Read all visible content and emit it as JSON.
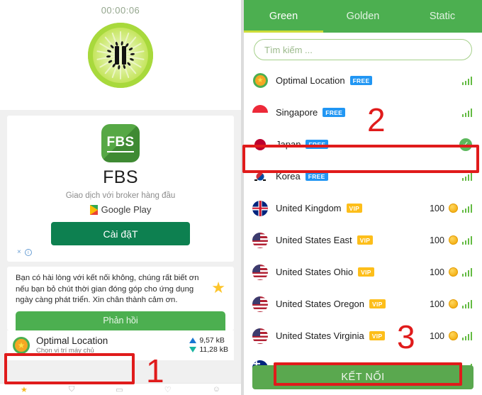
{
  "left": {
    "timer": "00:00:06",
    "pause_icon": "pause-icon",
    "ad": {
      "logo_text": "FBS",
      "title": "FBS",
      "subtitle": "Giao dịch với broker hàng đầu",
      "store_label": "Google Play",
      "install_label": "Cài đặT",
      "close_label": "×",
      "info_label": "i"
    },
    "feedback": {
      "text": "Bạn có hài lòng với kết nối không, chúng rất biết ơn nếu bạn bỏ chút thời gian đóng góp cho ứng dụng ngày càng phát triển. Xin chân thành cảm ơn.",
      "star_icon": "★",
      "button_label": "Phản hồi"
    },
    "optimal": {
      "title": "Optimal Location",
      "subtitle": "Chọn vị trí máy chủ",
      "upload": "9,57 kB",
      "download": "11,28 kB",
      "star_icon": "★"
    },
    "nav": [
      "★",
      "⛉",
      "▭",
      "♡",
      "☺"
    ]
  },
  "right": {
    "tabs": [
      {
        "label": "Green",
        "active": true
      },
      {
        "label": "Golden",
        "active": false
      },
      {
        "label": "Static",
        "active": false
      }
    ],
    "search": {
      "placeholder": "Tìm kiếm ...",
      "value": ""
    },
    "servers": [
      {
        "name": "Optimal Location",
        "badge": "FREE",
        "badge_type": "free",
        "flag": "star",
        "right": "signal",
        "cost": ""
      },
      {
        "name": "Singapore",
        "badge": "FREE",
        "badge_type": "free",
        "flag": "sg",
        "right": "signal",
        "cost": ""
      },
      {
        "name": "Japan",
        "badge": "FREE",
        "badge_type": "free",
        "flag": "jp",
        "right": "check",
        "cost": ""
      },
      {
        "name": "Korea",
        "badge": "FREE",
        "badge_type": "free",
        "flag": "kr",
        "right": "signal",
        "cost": ""
      },
      {
        "name": "United Kingdom",
        "badge": "VIP",
        "badge_type": "vip",
        "flag": "uk",
        "right": "signal",
        "cost": "100"
      },
      {
        "name": "United States East",
        "badge": "VIP",
        "badge_type": "vip",
        "flag": "us",
        "right": "signal",
        "cost": "100"
      },
      {
        "name": "United States Ohio",
        "badge": "VIP",
        "badge_type": "vip",
        "flag": "us",
        "right": "signal",
        "cost": "100"
      },
      {
        "name": "United States Oregon",
        "badge": "VIP",
        "badge_type": "vip",
        "flag": "us",
        "right": "signal",
        "cost": "100"
      },
      {
        "name": "United States Virginia",
        "badge": "VIP",
        "badge_type": "vip",
        "flag": "us",
        "right": "signal",
        "cost": "100"
      },
      {
        "name": "",
        "badge": "",
        "badge_type": "",
        "flag": "au",
        "right": "signal",
        "cost": ""
      }
    ],
    "connect_label": "KẾT NỐI"
  },
  "annotations": {
    "one": "1",
    "two": "2",
    "three": "3",
    "box_color": "#e01b1b"
  }
}
